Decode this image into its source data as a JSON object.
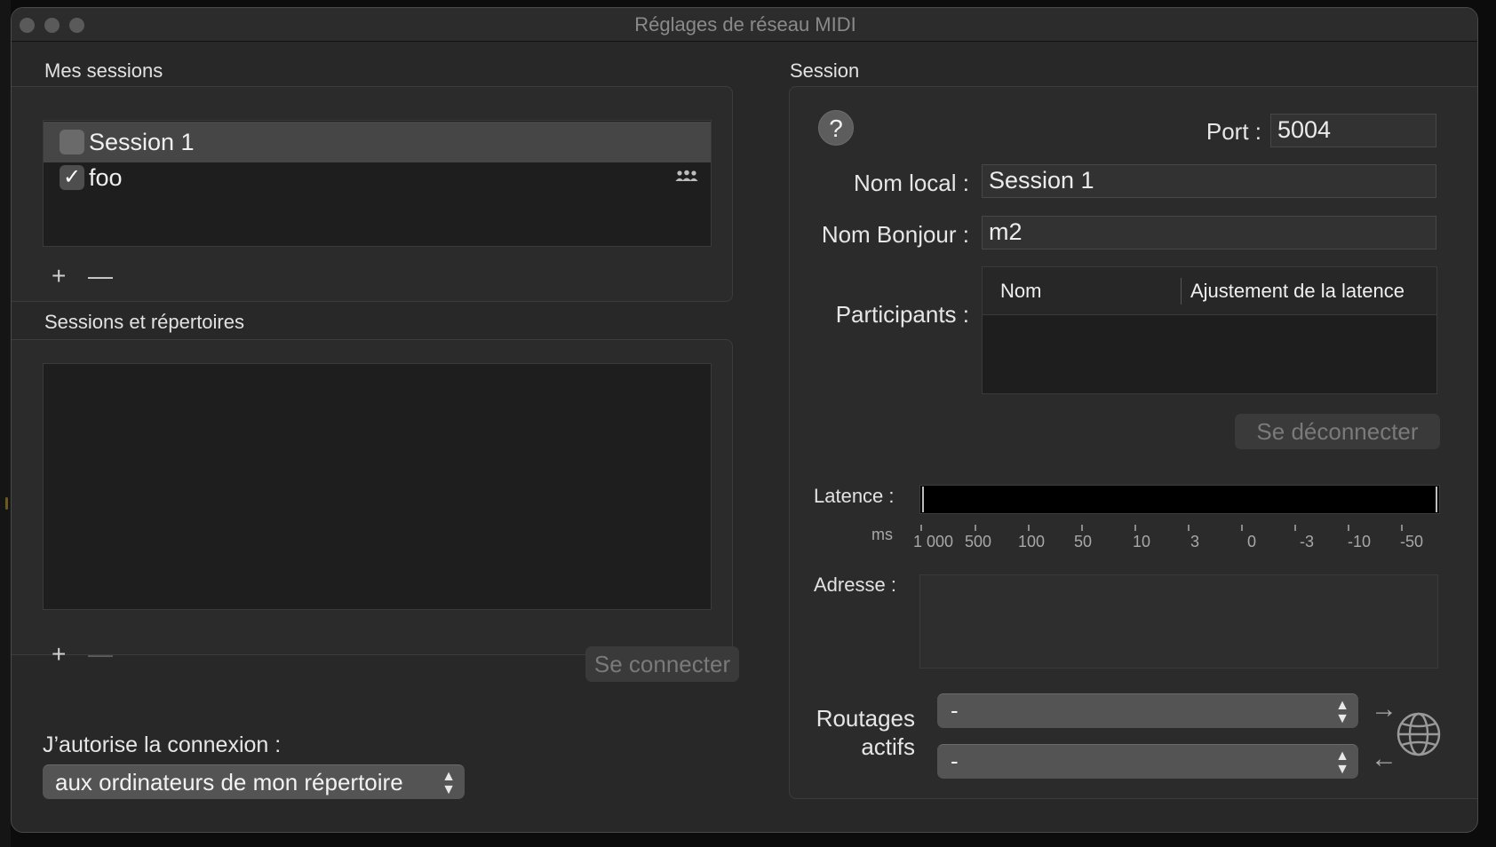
{
  "window": {
    "title": "Réglages de réseau MIDI"
  },
  "my_sessions": {
    "label": "Mes sessions",
    "items": [
      {
        "label": "Session 1",
        "checked": false,
        "selected": true
      },
      {
        "label": "foo",
        "checked": true,
        "selected": false,
        "icon": "people-icon"
      }
    ],
    "add_label": "+",
    "remove_label": "—"
  },
  "directory": {
    "label": "Sessions et répertoires",
    "add_label": "+",
    "remove_label": "—",
    "connect_label": "Se connecter"
  },
  "allow": {
    "label": "J’autorise la connexion :",
    "value": "aux ordinateurs de mon répertoire"
  },
  "session": {
    "label": "Session",
    "help_label": "?",
    "port_label": "Port :",
    "port_value": "5004",
    "local_name_label": "Nom local :",
    "local_name_value": "Session 1",
    "bonjour_label": "Nom Bonjour :",
    "bonjour_value": "m2",
    "participants_label": "Participants :",
    "participants_columns": [
      "Nom",
      "Ajustement de la latence"
    ],
    "disconnect_label": "Se déconnecter",
    "latency_label": "Latence :",
    "latency_unit": "ms",
    "latency_scale": [
      "1 000",
      "500",
      "100",
      "50",
      "10",
      "3",
      "0",
      "-3",
      "-10",
      "-50"
    ],
    "address_label": "Adresse :",
    "routes_label_1": "Routages",
    "routes_label_2": "actifs",
    "route_out_value": "-",
    "route_in_value": "-"
  }
}
